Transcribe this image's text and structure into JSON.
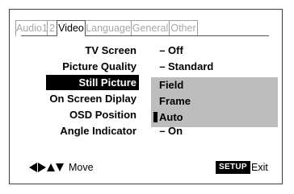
{
  "tabs": [
    {
      "label": "Audio1"
    },
    {
      "label": "2"
    },
    {
      "label": "Video"
    },
    {
      "label": "Language"
    },
    {
      "label": "General"
    },
    {
      "label": "Other"
    }
  ],
  "settings": [
    {
      "label": "TV Screen",
      "separator": "–",
      "value": "Off"
    },
    {
      "label": "Picture Quality",
      "separator": "–",
      "value": "Standard"
    },
    {
      "label": "Still Picture",
      "separator": "",
      "value": ""
    },
    {
      "label": "On Screen Diplay",
      "separator": "-",
      "value": ""
    },
    {
      "label": "OSD Position",
      "separator": "-",
      "value": ""
    },
    {
      "label": "Angle Indicator",
      "separator": "–",
      "value": "On"
    }
  ],
  "dropdown": {
    "options": [
      "Field",
      "Frame",
      "Auto"
    ],
    "current": "Auto"
  },
  "footer": {
    "move_label": "Move",
    "setup_label": "SETUP",
    "exit_label": "Exit"
  },
  "colors": {
    "dropdown_bg": "#bdbdbd",
    "selected_bg": "#000000",
    "inactive_tab_text": "#a6a6a6"
  }
}
